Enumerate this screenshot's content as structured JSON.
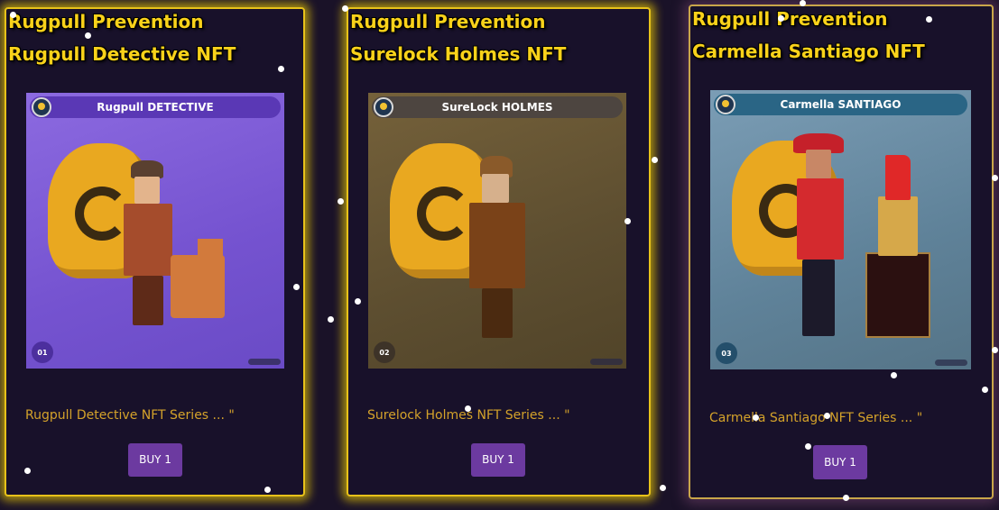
{
  "cards": [
    {
      "title": "Rugpull Prevention",
      "name": "Rugpull Detective NFT",
      "art_banner": "Rugpull DETECTIVE",
      "art_number": "01",
      "description": "Rugpull Detective NFT Series ... \"",
      "buy_label": "BUY 1"
    },
    {
      "title": "Rugpull Prevention",
      "name": "Surelock Holmes NFT",
      "art_banner": "SureLock HOLMES",
      "art_number": "02",
      "description": "Surelock Holmes NFT Series ... \"",
      "buy_label": "BUY 1"
    },
    {
      "title": "Rugpull Prevention",
      "name": "Carmella Santiago NFT",
      "art_banner": "Carmella SANTIAGO",
      "art_number": "03",
      "description": "Carmella Santiago NFT Series ... \"",
      "buy_label": "BUY 1"
    }
  ],
  "colors": {
    "background": "#1a1228",
    "card_border": "#e8c21a",
    "title_text": "#f9d21a",
    "description_text": "#d4a22a",
    "buy_button": "#6c3aa0"
  }
}
